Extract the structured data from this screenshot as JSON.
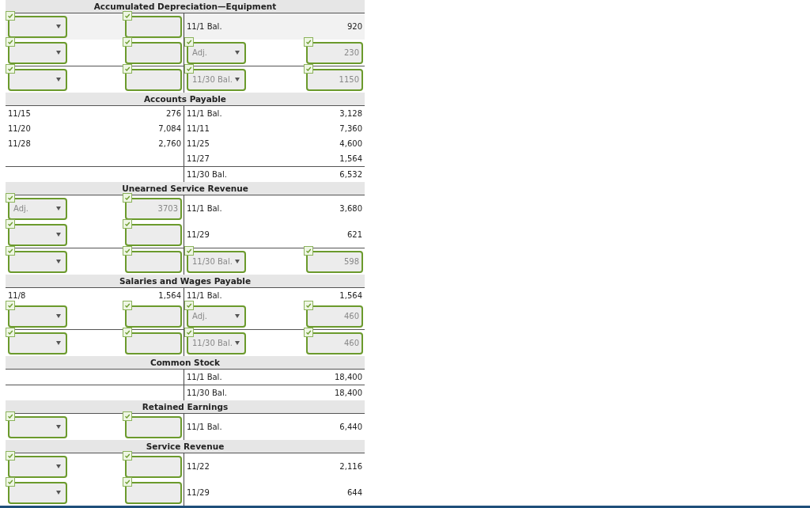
{
  "accounts": [
    {
      "title": "Accumulated Depreciation—Equipment",
      "rows": [
        {
          "highlighted": true,
          "total": false,
          "cells": [
            {
              "kind": "select",
              "checked": true
            },
            {
              "kind": "input",
              "checked": true
            },
            {
              "kind": "text",
              "value": "11/1 Bal."
            },
            {
              "kind": "text",
              "value": "920"
            }
          ]
        },
        {
          "highlighted": false,
          "total": false,
          "cells": [
            {
              "kind": "select",
              "checked": true
            },
            {
              "kind": "input",
              "checked": true
            },
            {
              "kind": "select",
              "value": "Adj.",
              "checked": true
            },
            {
              "kind": "input",
              "value": "230",
              "checked": true
            }
          ]
        },
        {
          "highlighted": false,
          "total": true,
          "cells": [
            {
              "kind": "select",
              "checked": true
            },
            {
              "kind": "input",
              "checked": true
            },
            {
              "kind": "select",
              "value": "11/30 Bal.",
              "checked": true
            },
            {
              "kind": "input",
              "value": "1150",
              "checked": true
            }
          ]
        }
      ]
    },
    {
      "title": "Accounts Payable",
      "rows": [
        {
          "highlighted": false,
          "total": false,
          "cells": [
            {
              "kind": "text",
              "value": "11/15"
            },
            {
              "kind": "text",
              "value": "276"
            },
            {
              "kind": "text",
              "value": "11/1 Bal."
            },
            {
              "kind": "text",
              "value": "3,128"
            }
          ]
        },
        {
          "highlighted": false,
          "total": false,
          "cells": [
            {
              "kind": "text",
              "value": "11/20"
            },
            {
              "kind": "text",
              "value": "7,084"
            },
            {
              "kind": "text",
              "value": "11/11"
            },
            {
              "kind": "text",
              "value": "7,360"
            }
          ]
        },
        {
          "highlighted": false,
          "total": false,
          "cells": [
            {
              "kind": "text",
              "value": "11/28"
            },
            {
              "kind": "text",
              "value": "2,760"
            },
            {
              "kind": "text",
              "value": "11/25"
            },
            {
              "kind": "text",
              "value": "4,600"
            }
          ]
        },
        {
          "highlighted": false,
          "total": false,
          "cells": [
            {
              "kind": "blank"
            },
            {
              "kind": "blank"
            },
            {
              "kind": "text",
              "value": "11/27"
            },
            {
              "kind": "text",
              "value": "1,564"
            }
          ]
        },
        {
          "highlighted": false,
          "total": true,
          "cells": [
            {
              "kind": "blank"
            },
            {
              "kind": "blank"
            },
            {
              "kind": "text",
              "value": "11/30 Bal."
            },
            {
              "kind": "text",
              "value": "6,532"
            }
          ]
        }
      ]
    },
    {
      "title": "Unearned Service Revenue",
      "rows": [
        {
          "highlighted": false,
          "total": false,
          "cells": [
            {
              "kind": "select",
              "value": "Adj.",
              "checked": true
            },
            {
              "kind": "input",
              "value": "3703",
              "checked": true
            },
            {
              "kind": "text",
              "value": "11/1 Bal."
            },
            {
              "kind": "text",
              "value": "3,680"
            }
          ]
        },
        {
          "highlighted": false,
          "total": false,
          "cells": [
            {
              "kind": "select",
              "checked": true
            },
            {
              "kind": "input",
              "checked": true
            },
            {
              "kind": "text",
              "value": "11/29"
            },
            {
              "kind": "text",
              "value": "621"
            }
          ]
        },
        {
          "highlighted": false,
          "total": true,
          "cells": [
            {
              "kind": "select",
              "checked": true
            },
            {
              "kind": "input",
              "checked": true
            },
            {
              "kind": "select",
              "value": "11/30 Bal.",
              "checked": true
            },
            {
              "kind": "input",
              "value": "598",
              "checked": true
            }
          ]
        }
      ]
    },
    {
      "title": "Salaries and Wages Payable",
      "rows": [
        {
          "highlighted": false,
          "total": false,
          "cells": [
            {
              "kind": "text",
              "value": "11/8"
            },
            {
              "kind": "text",
              "value": "1,564"
            },
            {
              "kind": "text",
              "value": "11/1 Bal."
            },
            {
              "kind": "text",
              "value": "1,564"
            }
          ]
        },
        {
          "highlighted": false,
          "total": false,
          "cells": [
            {
              "kind": "select",
              "checked": true
            },
            {
              "kind": "input",
              "checked": true
            },
            {
              "kind": "select",
              "value": "Adj.",
              "checked": true
            },
            {
              "kind": "input",
              "value": "460",
              "checked": true
            }
          ]
        },
        {
          "highlighted": false,
          "total": true,
          "cells": [
            {
              "kind": "select",
              "checked": true
            },
            {
              "kind": "input",
              "checked": true
            },
            {
              "kind": "select",
              "value": "11/30 Bal.",
              "checked": true
            },
            {
              "kind": "input",
              "value": "460",
              "checked": true
            }
          ]
        }
      ]
    },
    {
      "title": "Common Stock",
      "rows": [
        {
          "highlighted": false,
          "total": false,
          "cells": [
            {
              "kind": "blank"
            },
            {
              "kind": "blank"
            },
            {
              "kind": "text",
              "value": "11/1 Bal."
            },
            {
              "kind": "text",
              "value": "18,400"
            }
          ]
        },
        {
          "highlighted": false,
          "total": true,
          "cells": [
            {
              "kind": "blank"
            },
            {
              "kind": "blank"
            },
            {
              "kind": "text",
              "value": "11/30 Bal."
            },
            {
              "kind": "text",
              "value": "18,400"
            }
          ]
        }
      ]
    },
    {
      "title": "Retained Earnings",
      "rows": [
        {
          "highlighted": false,
          "total": false,
          "cells": [
            {
              "kind": "select",
              "checked": true
            },
            {
              "kind": "input",
              "checked": true
            },
            {
              "kind": "text",
              "value": "11/1 Bal."
            },
            {
              "kind": "text",
              "value": "6,440"
            }
          ]
        }
      ]
    },
    {
      "title": "Service Revenue",
      "rows": [
        {
          "highlighted": false,
          "total": false,
          "cells": [
            {
              "kind": "select",
              "checked": true
            },
            {
              "kind": "input",
              "checked": true
            },
            {
              "kind": "text",
              "value": "11/22"
            },
            {
              "kind": "text",
              "value": "2,116"
            }
          ]
        },
        {
          "highlighted": false,
          "total": false,
          "cells": [
            {
              "kind": "select",
              "checked": true
            },
            {
              "kind": "input",
              "checked": true
            },
            {
              "kind": "text",
              "value": "11/29"
            },
            {
              "kind": "text",
              "value": "644"
            }
          ]
        }
      ]
    }
  ]
}
